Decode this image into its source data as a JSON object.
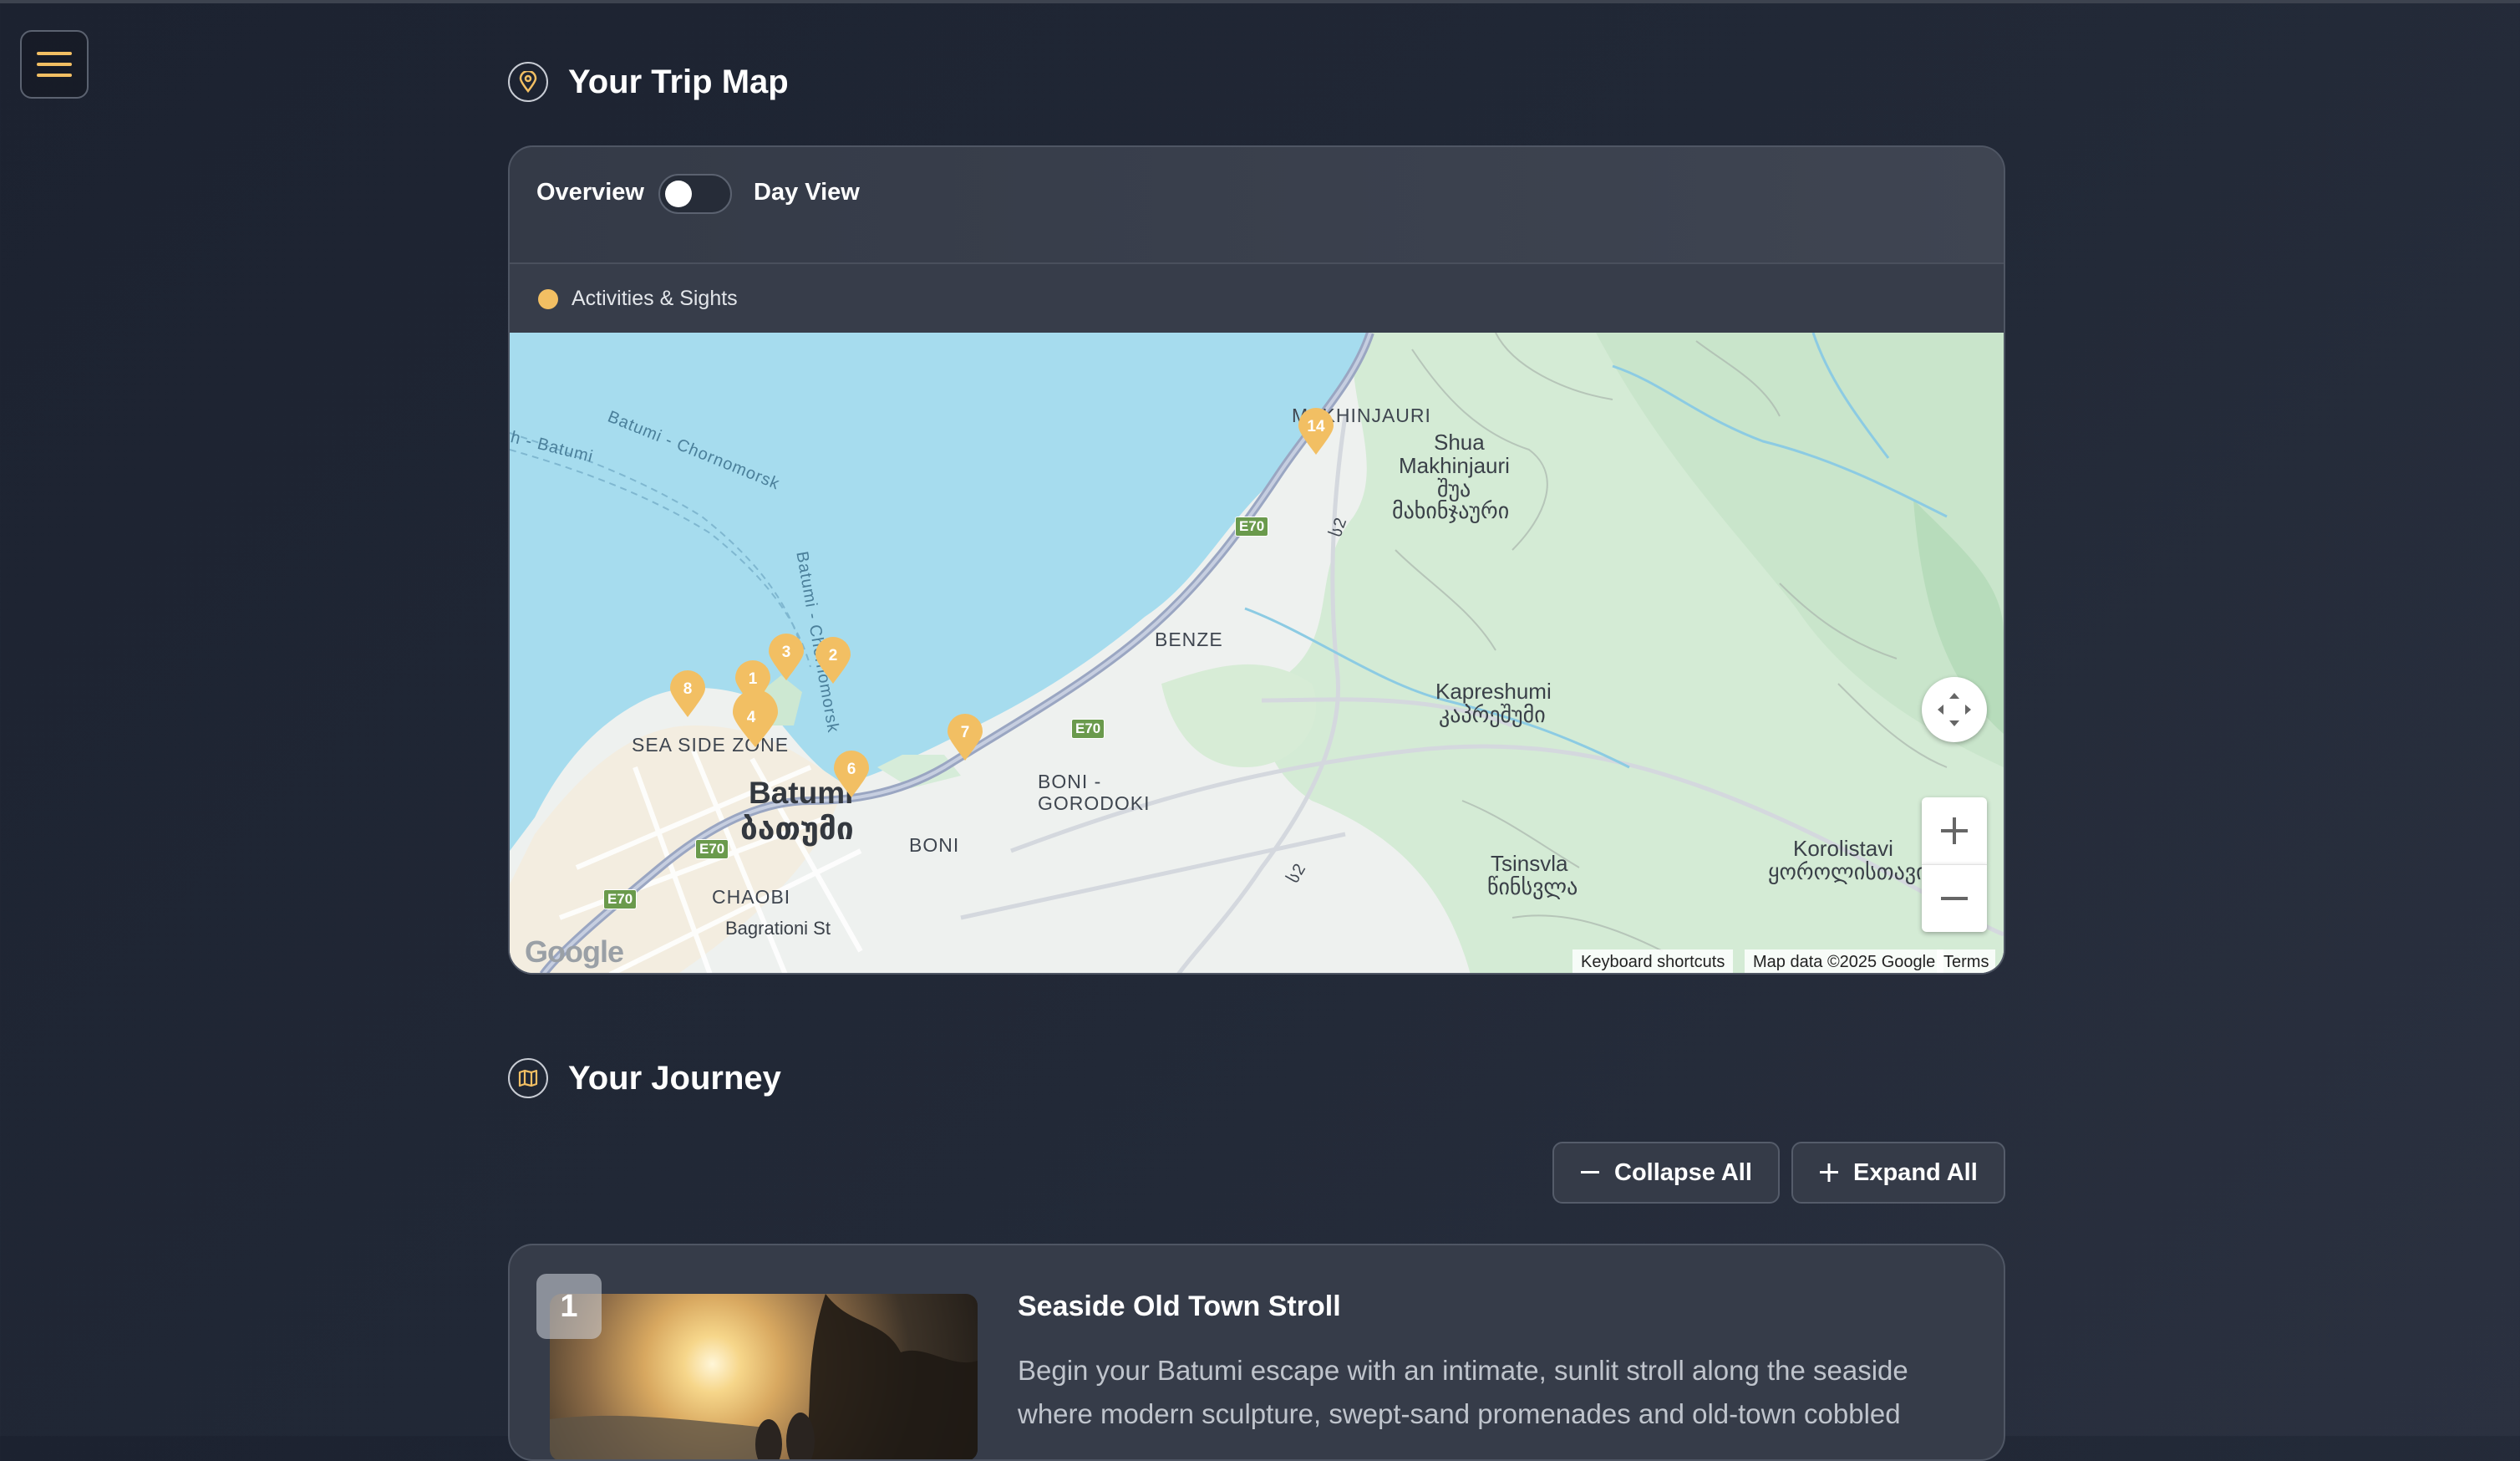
{
  "map_section": {
    "title": "Your Trip Map",
    "toggle": {
      "left_label": "Overview",
      "right_label": "Day View",
      "day_view_enabled": false
    },
    "legend": [
      {
        "label": "Activities & Sights",
        "color": "#f2bf63"
      }
    ],
    "map": {
      "labels": {
        "makhinjauri": "MAKHINJAURI",
        "shua_1": "Shua",
        "shua_2": "Makhinjauri",
        "shua_geo_1": "შუა",
        "shua_geo_2": "მახინჯაური",
        "benze": "BENZE",
        "kapreshumi": "Kapreshumi",
        "kapreshumi_geo": "კაპრეშუმი",
        "sea_side_zone": "SEA SIDE ZONE",
        "batumi": "Batumi",
        "batumi_geo": "ბათუმი",
        "boni_gorodoki_1": "BONI -",
        "boni_gorodoki_2": "GORODOKI",
        "boni": "BONI",
        "chaobi": "CHAOBI",
        "bagrationi": "Bagrationi St",
        "tsinsvla": "Tsinsvla",
        "tsinsvla_geo": "წინსვლა",
        "korolistavi": "Korolistavi",
        "korolistavi_geo": "ყოროლისთავი",
        "batumi_chornomorsk": "Batumi - Chornomorsk",
        "batumi_chornomorsk_2": "Batumi - Chornomorsk",
        "batumi_left": "h - Batumi",
        "road_e70": "E70",
        "road_s2": "ს2"
      },
      "markers": [
        "14",
        "3",
        "2",
        "1",
        "8",
        "4",
        "7",
        "6"
      ],
      "attribution": {
        "shortcuts": "Keyboard shortcuts",
        "data": "Map data ©2025 Google",
        "terms": "Terms",
        "logo": "Google"
      }
    }
  },
  "journey_section": {
    "title": "Your Journey",
    "collapse_label": "Collapse All",
    "expand_label": "Expand All",
    "days": [
      {
        "number": "1",
        "title": "Seaside Old Town Stroll",
        "description": "Begin your Batumi escape with an intimate, sunlit stroll along the seaside where modern sculpture, swept-sand promenades and old-town cobbled"
      }
    ]
  },
  "colors": {
    "accent": "#f2bf63",
    "water": "#a6dcee",
    "park": "#cfe8cf"
  },
  "icons": {
    "menu": "hamburger-icon",
    "map": "map-pin-icon",
    "journey": "map-fold-icon"
  }
}
